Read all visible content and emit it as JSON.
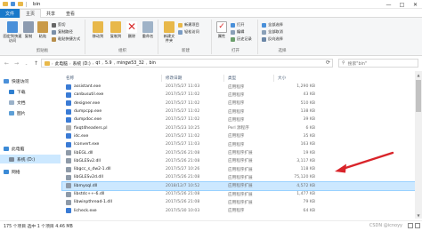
{
  "window": {
    "title": "bin",
    "controls": [
      "—",
      "□",
      "✕"
    ]
  },
  "ribbon_tabs": [
    "文件",
    "主页",
    "共享",
    "查看"
  ],
  "ribbon": {
    "clipboard": {
      "label": "剪贴板",
      "pin": "固定到快速访问",
      "copy": "复制",
      "paste": "粘贴",
      "cut": "剪切",
      "copy_path": "复制路径",
      "paste_shortcut": "粘贴快捷方式"
    },
    "organize": {
      "label": "组织",
      "move_to": "移动到",
      "copy_to": "复制到",
      "delete": "删除",
      "rename": "重命名"
    },
    "new": {
      "label": "新建",
      "new_folder": "新建文件夹",
      "new_item": "新建项目",
      "easy_access": "轻松访问"
    },
    "open": {
      "label": "打开",
      "properties": "属性",
      "open": "打开",
      "edit": "编辑",
      "history": "历史记录"
    },
    "select": {
      "label": "选择",
      "select_all": "全部选择",
      "select_none": "全部取消",
      "invert": "反向选择"
    }
  },
  "address": {
    "segments": [
      "此电脑",
      "系统 (D:)",
      "qt",
      "5.9",
      "mingw53_32",
      "bin"
    ],
    "search_placeholder": "搜索\"bin\""
  },
  "nav_pane": [
    {
      "label": "快速访问"
    },
    {
      "label": "下载"
    },
    {
      "label": "文档"
    },
    {
      "label": "图片"
    },
    {
      "label": "此电脑"
    },
    {
      "label": "系统 (D:)",
      "selected": true
    },
    {
      "label": "网络"
    }
  ],
  "columns": {
    "name": "名称",
    "date": "修改日期",
    "type": "类型",
    "size": "大小"
  },
  "files": [
    {
      "name": "assistant.exe",
      "date": "2017/5/27 11:03",
      "type": "应用程序",
      "size": "1,290 KB",
      "icon": "exe"
    },
    {
      "name": "canbusutil.exe",
      "date": "2017/5/27 11:02",
      "type": "应用程序",
      "size": "43 KB",
      "icon": "exe"
    },
    {
      "name": "designer.exe",
      "date": "2017/5/27 11:02",
      "type": "应用程序",
      "size": "510 KB",
      "icon": "exe"
    },
    {
      "name": "dumpcpp.exe",
      "date": "2017/5/27 11:02",
      "type": "应用程序",
      "size": "138 KB",
      "icon": "exe"
    },
    {
      "name": "dumpdoc.exe",
      "date": "2017/5/27 11:02",
      "type": "应用程序",
      "size": "39 KB",
      "icon": "exe"
    },
    {
      "name": "fixqt4headers.pl",
      "date": "2017/5/23 10:25",
      "type": "Perl 源程序",
      "size": "6 KB",
      "icon": "pl"
    },
    {
      "name": "idc.exe",
      "date": "2017/5/27 11:02",
      "type": "应用程序",
      "size": "35 KB",
      "icon": "exe"
    },
    {
      "name": "lconvert.exe",
      "date": "2017/5/27 11:03",
      "type": "应用程序",
      "size": "163 KB",
      "icon": "exe"
    },
    {
      "name": "libEGL.dll",
      "date": "2017/5/26 21:08",
      "type": "应用程序扩展",
      "size": "19 KB",
      "icon": "dll"
    },
    {
      "name": "libGLESv2.dll",
      "date": "2017/5/26 21:08",
      "type": "应用程序扩展",
      "size": "3,117 KB",
      "icon": "dll"
    },
    {
      "name": "libgcc_s_dw2-1.dll",
      "date": "2017/5/27 10:26",
      "type": "应用程序扩展",
      "size": "118 KB",
      "icon": "dll"
    },
    {
      "name": "libGLESv2d.dll",
      "date": "2017/5/26 21:08",
      "type": "应用程序扩展",
      "size": "75,120 KB",
      "icon": "dll"
    },
    {
      "name": "libmysql.dll",
      "date": "2018/12/7 10:52",
      "type": "应用程序扩展",
      "size": "4,572 KB",
      "icon": "dll",
      "selected": true
    },
    {
      "name": "libstdc++-6.dll",
      "date": "2017/5/26 21:08",
      "type": "应用程序扩展",
      "size": "1,477 KB",
      "icon": "dll"
    },
    {
      "name": "libwinpthread-1.dll",
      "date": "2017/5/26 21:08",
      "type": "应用程序扩展",
      "size": "79 KB",
      "icon": "dll"
    },
    {
      "name": "licheck.exe",
      "date": "2017/5/30 10:03",
      "type": "应用程序",
      "size": "64 KB",
      "icon": "exe"
    }
  ],
  "status": {
    "text": "175 个项目   选中 1 个项目  4.46 MB",
    "watermark": "CSDN @icnoyy"
  },
  "colors": {
    "accent": "#1979ca",
    "selection": "#cce8ff",
    "arrow": "#d9242a",
    "folder": "#e8b84a"
  }
}
